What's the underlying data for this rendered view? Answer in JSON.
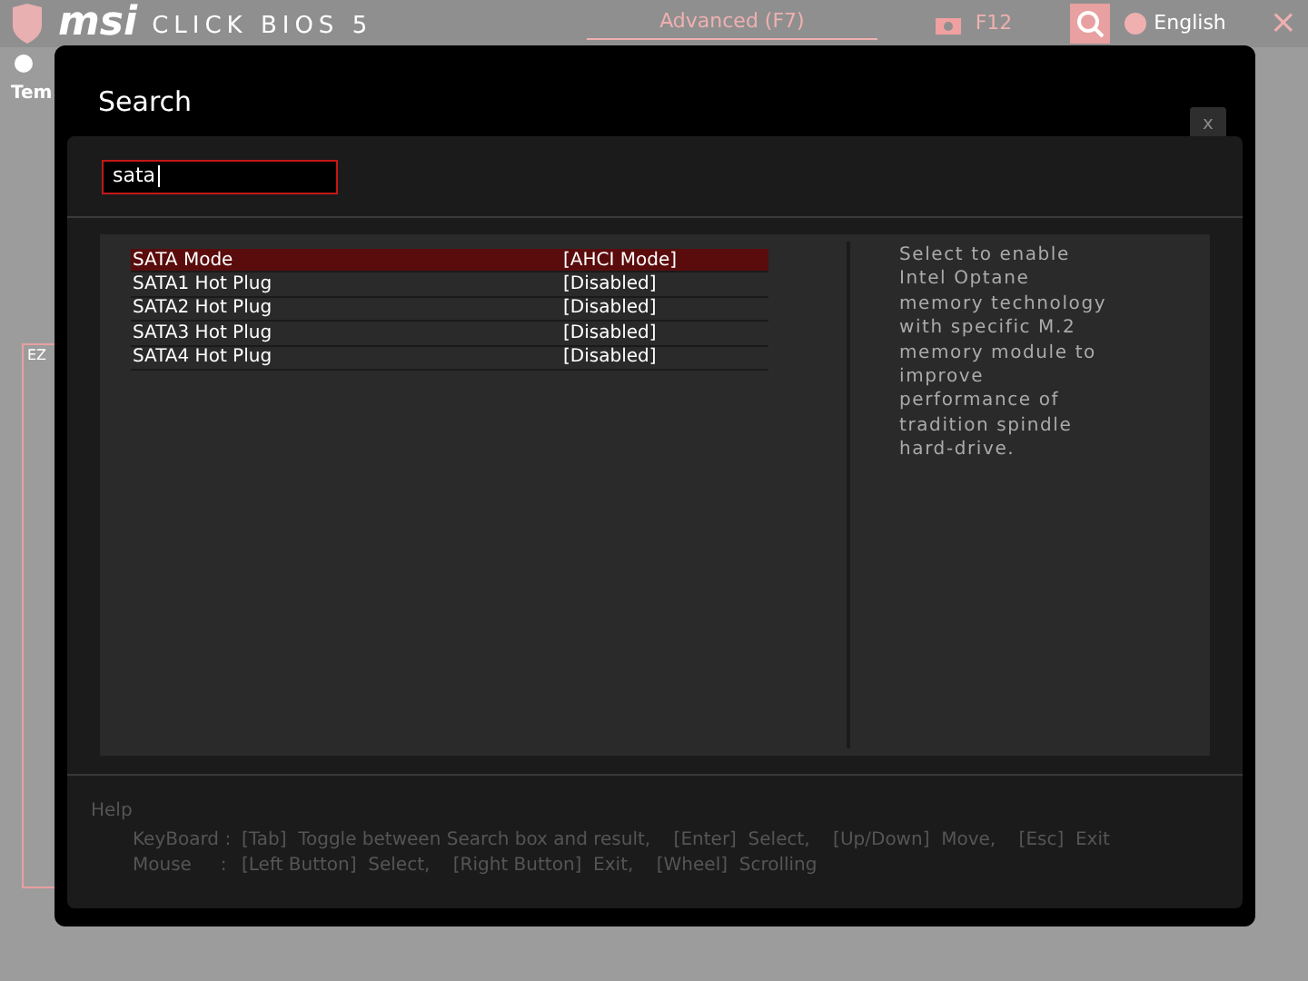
{
  "background": {
    "brand": "msi",
    "product": "CLICK BIOS 5",
    "mode_tab": "Advanced (F7)",
    "screenshot_key": "F12",
    "language": "English",
    "close": "×",
    "temp_label": "Tem",
    "ez_label": "EZ"
  },
  "dialog": {
    "title": "Search",
    "close": "x",
    "search": {
      "value": "sata"
    },
    "results": [
      {
        "name": "SATA Mode",
        "value": "[AHCI Mode]",
        "selected": true
      },
      {
        "name": "SATA1 Hot Plug",
        "value": "[Disabled]",
        "selected": false
      },
      {
        "name": "SATA2 Hot Plug",
        "value": "[Disabled]",
        "selected": false
      },
      {
        "name": "SATA3 Hot Plug",
        "value": "[Disabled]",
        "selected": false
      },
      {
        "name": "SATA4 Hot Plug",
        "value": "[Disabled]",
        "selected": false
      }
    ],
    "description": "Select to enable Intel Optane memory technology with specific M.2 memory module to improve performance of tradition spindle hard-drive.",
    "help": {
      "title": "Help",
      "lines": [
        {
          "label": "KeyBoard :",
          "text": "[Tab]  Toggle between Search box and result,    [Enter]  Select,    [Up/Down]  Move,    [Esc]  Exit"
        },
        {
          "label": "Mouse     :",
          "text": "[Left Button]  Select,    [Right Button]  Exit,    [Wheel]  Scrolling"
        }
      ]
    }
  }
}
